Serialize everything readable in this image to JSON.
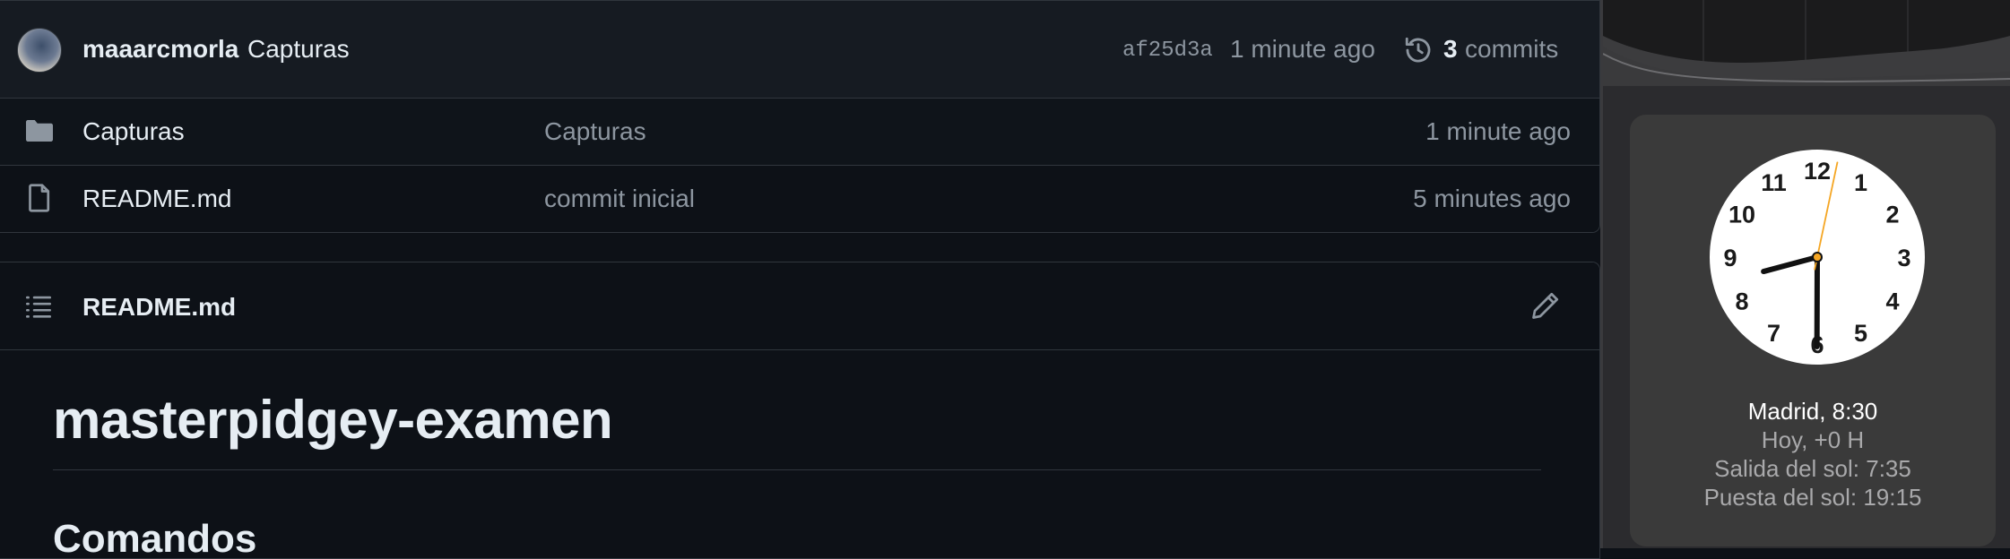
{
  "repo": {
    "latest_commit": {
      "author": "maaarcmorla",
      "message": "Capturas",
      "sha": "af25d3a",
      "time": "1 minute ago",
      "commits_count": "3",
      "commits_label": "commits"
    },
    "files": [
      {
        "icon": "folder-icon",
        "name": "Capturas",
        "message": "Capturas",
        "time": "1 minute ago"
      },
      {
        "icon": "file-icon",
        "name": "README.md",
        "message": "commit inicial",
        "time": "5 minutes ago"
      }
    ],
    "readme": {
      "file_label": "README.md",
      "h1": "masterpidgey-examen",
      "h2": "Comandos"
    }
  },
  "world_clock": {
    "city_time": "Madrid, 8:30",
    "offset": "Hoy, +0 H",
    "sunrise": "Salida del sol: 7:35",
    "sunset": "Puesta del sol: 19:15",
    "hour": 8,
    "minute": 30,
    "second": 2,
    "numerals": [
      "12",
      "1",
      "2",
      "3",
      "4",
      "5",
      "6",
      "7",
      "8",
      "9",
      "10",
      "11"
    ],
    "second_hand_color": "#f5a623"
  },
  "colors": {
    "bg": "#0d1117",
    "text": "#e6edf3",
    "muted": "#8d96a0",
    "border": "#30363d"
  }
}
